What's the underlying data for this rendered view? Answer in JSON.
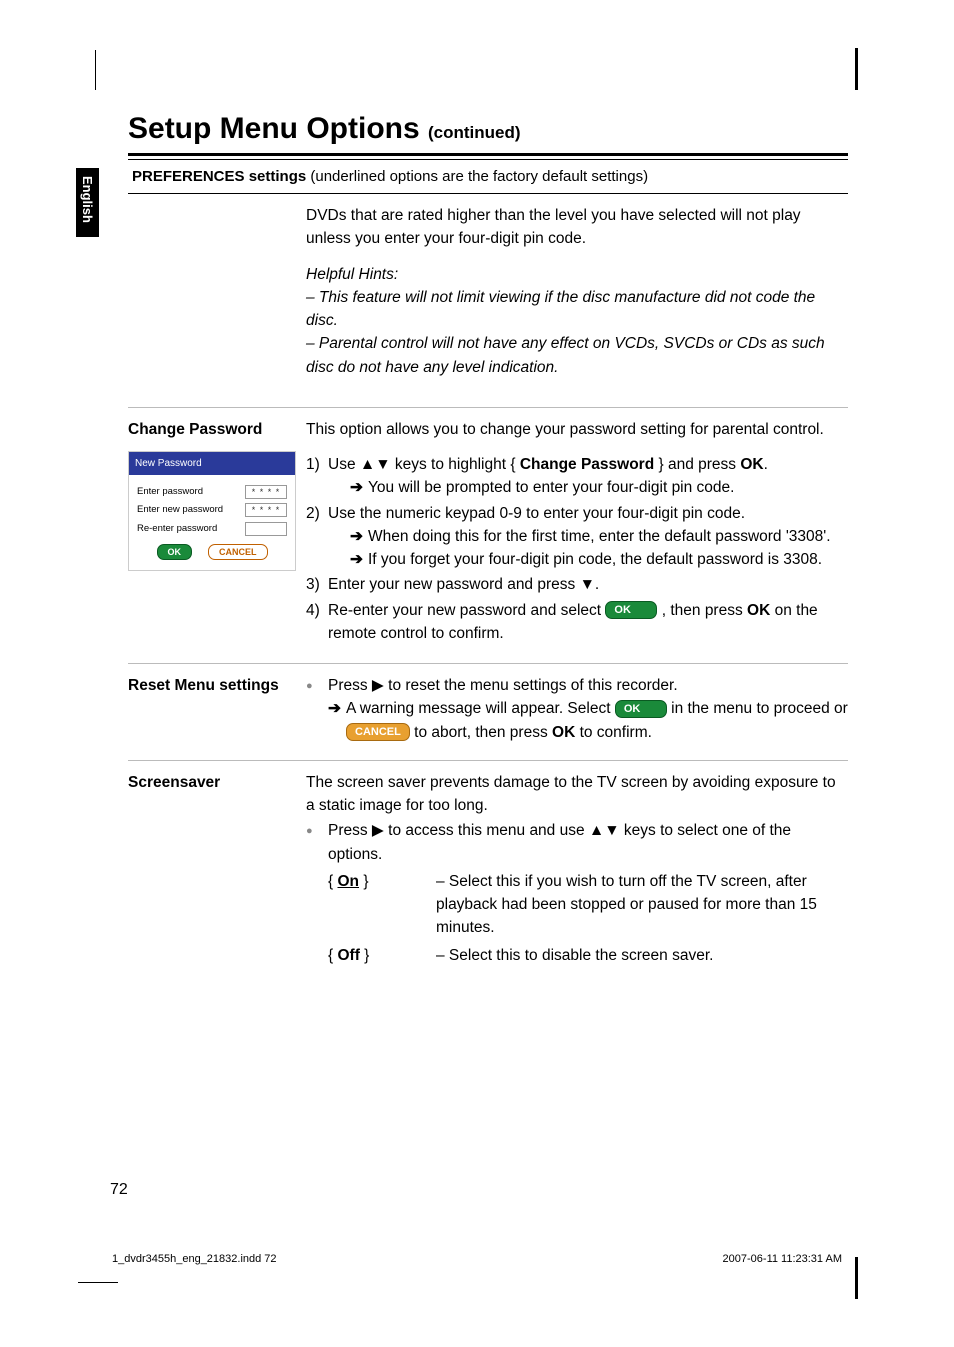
{
  "header": {
    "title": "Setup Menu Options",
    "continued": "(continued)"
  },
  "sidebar": {
    "language": "English"
  },
  "section_header": {
    "bold": "PREFERENCES settings",
    "rest": " (underlined options are the factory default settings)"
  },
  "rows": {
    "parental_intro_cont": "DVDs that are rated higher than the level you have selected will not play unless you enter your four-digit pin code.",
    "hints_title": "Helpful Hints:",
    "hints_body": "– This feature will not limit viewing if the disc manufacture did not code the disc.\n– Parental control will not have any effect on VCDs, SVCDs or CDs as such disc do not have any level indication.",
    "change_password": {
      "label": "Change Password",
      "intro": "This option allows you to change your password setting for parental control.",
      "step1_a": "Use ▲▼ keys to highlight { ",
      "step1_b": "Change Password",
      "step1_c": " } and press ",
      "step1_d": "OK",
      "step1_e": ".",
      "step1_arrow": "You will be prompted to enter your four-digit pin code.",
      "step2": "Use the numeric keypad 0-9 to enter your four-digit pin code.",
      "step2_arrow": "When doing this for the first time, enter the default password '3308'.",
      "step2_arrow2": "If you forget your four-digit pin code, the default password is 3308.",
      "step3": "Enter your new password and press ▼.",
      "step4_a": "Re-enter your new password and select ",
      "step4_b": " , then press ",
      "step4_c": "OK",
      "step4_d": " on the remote control to confirm.",
      "pill_ok": "OK",
      "card": {
        "title": "New Password",
        "f1": "Enter password",
        "f2": "Enter new password",
        "f3": "Re-enter password",
        "stars": "* * * *",
        "ok": "OK",
        "cancel": "CANCEL"
      }
    },
    "reset_menu": {
      "label": "Reset Menu settings",
      "line1": "Press ▶ to reset the menu settings of this recorder.",
      "arrow_a": "A warning message will appear. Select ",
      "arrow_b": " in the menu to proceed or ",
      "arrow_c": " to abort, then press ",
      "arrow_d": "OK",
      "arrow_e": " to confirm.",
      "pill_ok": "OK",
      "pill_cancel": "CANCEL"
    },
    "screensaver": {
      "label": "Screensaver",
      "intro": "The screen saver prevents damage to the TV screen by avoiding exposure to a static image for too long.",
      "bullet": "Press ▶ to access this menu and use ▲▼ keys to select one of the options.",
      "on_key": "{ On }",
      "on_desc": "– Select this if you wish to turn off the TV screen, after playback had been stopped or paused for more than 15 minutes.",
      "off_key": "{ Off }",
      "off_desc": "– Select this to disable the screen saver."
    }
  },
  "footer": {
    "page": "72",
    "file": "1_dvdr3455h_eng_21832.indd   72",
    "date": "2007-06-11   11:23:31 AM"
  }
}
